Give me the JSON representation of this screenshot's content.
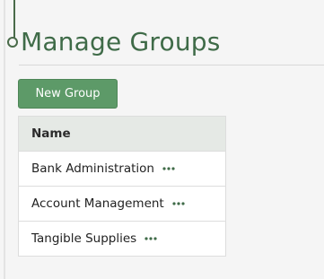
{
  "page": {
    "title": "Manage Groups"
  },
  "toolbar": {
    "new_group_label": "New Group"
  },
  "table": {
    "columns": [
      "Name"
    ],
    "rows": [
      {
        "name": "Bank Administration",
        "actions_icon": "more-horizontal-icon"
      },
      {
        "name": "Account Management",
        "actions_icon": "more-horizontal-icon"
      },
      {
        "name": "Tangible Supplies",
        "actions_icon": "more-horizontal-icon"
      }
    ]
  },
  "colors": {
    "accent": "#3f6b48",
    "button": "#5d9a68",
    "header_bg": "#e5e9e5"
  }
}
